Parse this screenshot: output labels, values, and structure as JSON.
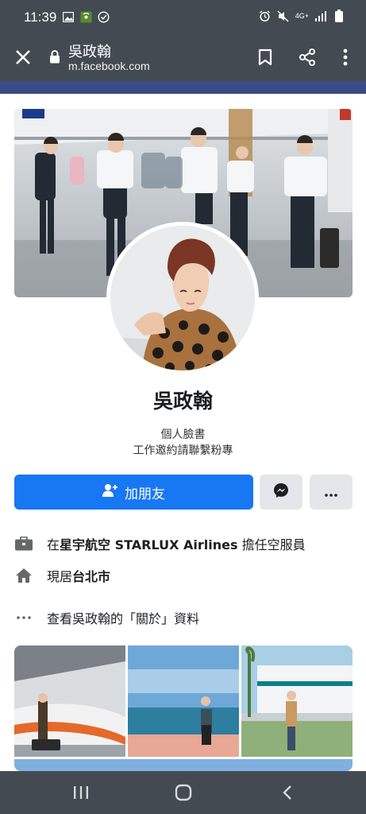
{
  "status_bar": {
    "time": "11:39",
    "network_label": "4G+"
  },
  "browser": {
    "page_title": "吳政翰",
    "url": "m.facebook.com"
  },
  "profile": {
    "name": "吳政翰",
    "bio_line1": "個人臉書",
    "bio_line2": "工作邀約請聯繫粉專",
    "add_friend_label": "加朋友",
    "work": {
      "prefix": "在",
      "company": "星宇航空 STARLUX Airlines",
      "suffix": " 擔任空服員"
    },
    "lives": {
      "prefix": "現居",
      "city": "台北市"
    },
    "about_link": "查看吳政翰的「關於」資料"
  },
  "photos": {
    "count_visible": 3
  },
  "colors": {
    "chrome": "#444a52",
    "accent": "#1877f2",
    "fb_bar": "#3b4b86",
    "secondary_button": "#e4e6eb"
  },
  "icons": [
    "close-icon",
    "lock-icon",
    "bookmark-icon",
    "share-icon",
    "more-vert-icon",
    "add-friend-icon",
    "messenger-icon",
    "more-horiz-icon",
    "briefcase-icon",
    "home-icon",
    "dots-icon",
    "recents-icon",
    "home-nav-icon",
    "back-icon"
  ]
}
